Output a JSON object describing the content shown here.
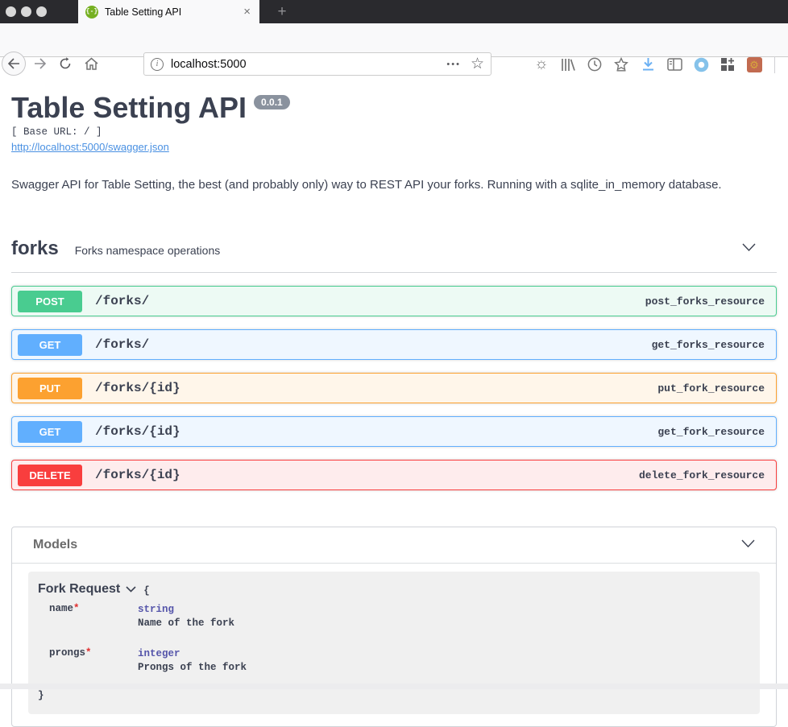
{
  "browser": {
    "tab": {
      "title": "Table Setting API",
      "close_glyph": "×",
      "new_tab_glyph": "+",
      "favicon_glyph": "{-}"
    },
    "urlbar": {
      "url": "localhost:5000",
      "info_glyph": "i",
      "ellipsis_glyph": "•••",
      "star_glyph": "☆"
    },
    "toolbar": {
      "sun_glyph": "☼",
      "gear_glyph": "⚙"
    }
  },
  "api": {
    "title": "Table Setting API",
    "version": "0.0.1",
    "base_url_label": "[ Base URL: / ]",
    "spec_link": "http://localhost:5000/swagger.json",
    "description": "Swagger API for Table Setting, the best (and probably only) way to REST API your forks. Running with a sqlite_in_memory database."
  },
  "section": {
    "name": "forks",
    "description": "Forks namespace operations",
    "operations": [
      {
        "method": "POST",
        "path": "/forks/",
        "operation_id": "post_forks_resource",
        "color": "#49cc90",
        "bg": "#edfaf4"
      },
      {
        "method": "GET",
        "path": "/forks/",
        "operation_id": "get_forks_resource",
        "color": "#61affe",
        "bg": "#eff7ff"
      },
      {
        "method": "PUT",
        "path": "/forks/{id}",
        "operation_id": "put_fork_resource",
        "color": "#fca130",
        "bg": "#fff6ea"
      },
      {
        "method": "GET",
        "path": "/forks/{id}",
        "operation_id": "get_fork_resource",
        "color": "#61affe",
        "bg": "#eff7ff"
      },
      {
        "method": "DELETE",
        "path": "/forks/{id}",
        "operation_id": "delete_fork_resource",
        "color": "#f93e3e",
        "bg": "#feeced"
      }
    ]
  },
  "models": {
    "title": "Models",
    "model": {
      "name": "Fork Request",
      "open_brace": "{",
      "close_brace": "}",
      "properties": [
        {
          "name": "name",
          "required": "*",
          "type": "string",
          "description": "Name of the fork"
        },
        {
          "name": "prongs",
          "required": "*",
          "type": "integer",
          "description": "Prongs of the fork"
        }
      ]
    }
  },
  "colors": {
    "text": "#3b4151",
    "link": "#4990e2",
    "post": "#49cc90",
    "get": "#61affe",
    "put": "#fca130",
    "delete": "#f93e3e",
    "download_accent": "#6bb0f3"
  }
}
